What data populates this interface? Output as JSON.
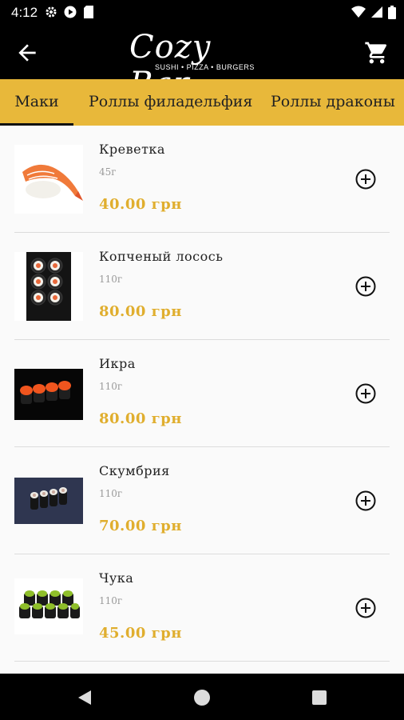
{
  "status_bar": {
    "time": "4:12"
  },
  "brand": {
    "script": "Cozy Bar",
    "tagline": "SUSHI • PIZZA • BURGERS"
  },
  "tabs": [
    {
      "label": "Маки",
      "active": true
    },
    {
      "label": "Роллы филадельфия",
      "active": false
    },
    {
      "label": "Роллы драконы",
      "active": false
    }
  ],
  "items": [
    {
      "name": "Креветка",
      "weight": "45г",
      "price": "40.00 грн",
      "image": "shrimp-nigiri"
    },
    {
      "name": "Копченый лосось",
      "weight": "110г",
      "price": "80.00 грн",
      "image": "smoked-salmon-maki"
    },
    {
      "name": "Икра",
      "weight": "110г",
      "price": "80.00 грн",
      "image": "caviar-maki"
    },
    {
      "name": "Скумбрия",
      "weight": "110г",
      "price": "70.00 грн",
      "image": "mackerel-maki"
    },
    {
      "name": "Чука",
      "weight": "110г",
      "price": "45.00 грн",
      "image": "chuka-maki"
    }
  ],
  "colors": {
    "accent": "#e8b83a",
    "price": "#e0ae2e",
    "bar": "#000000"
  },
  "icons": [
    "back-arrow-icon",
    "cart-icon",
    "add-circle-icon",
    "nav-back-icon",
    "nav-home-icon",
    "nav-recents-icon"
  ]
}
